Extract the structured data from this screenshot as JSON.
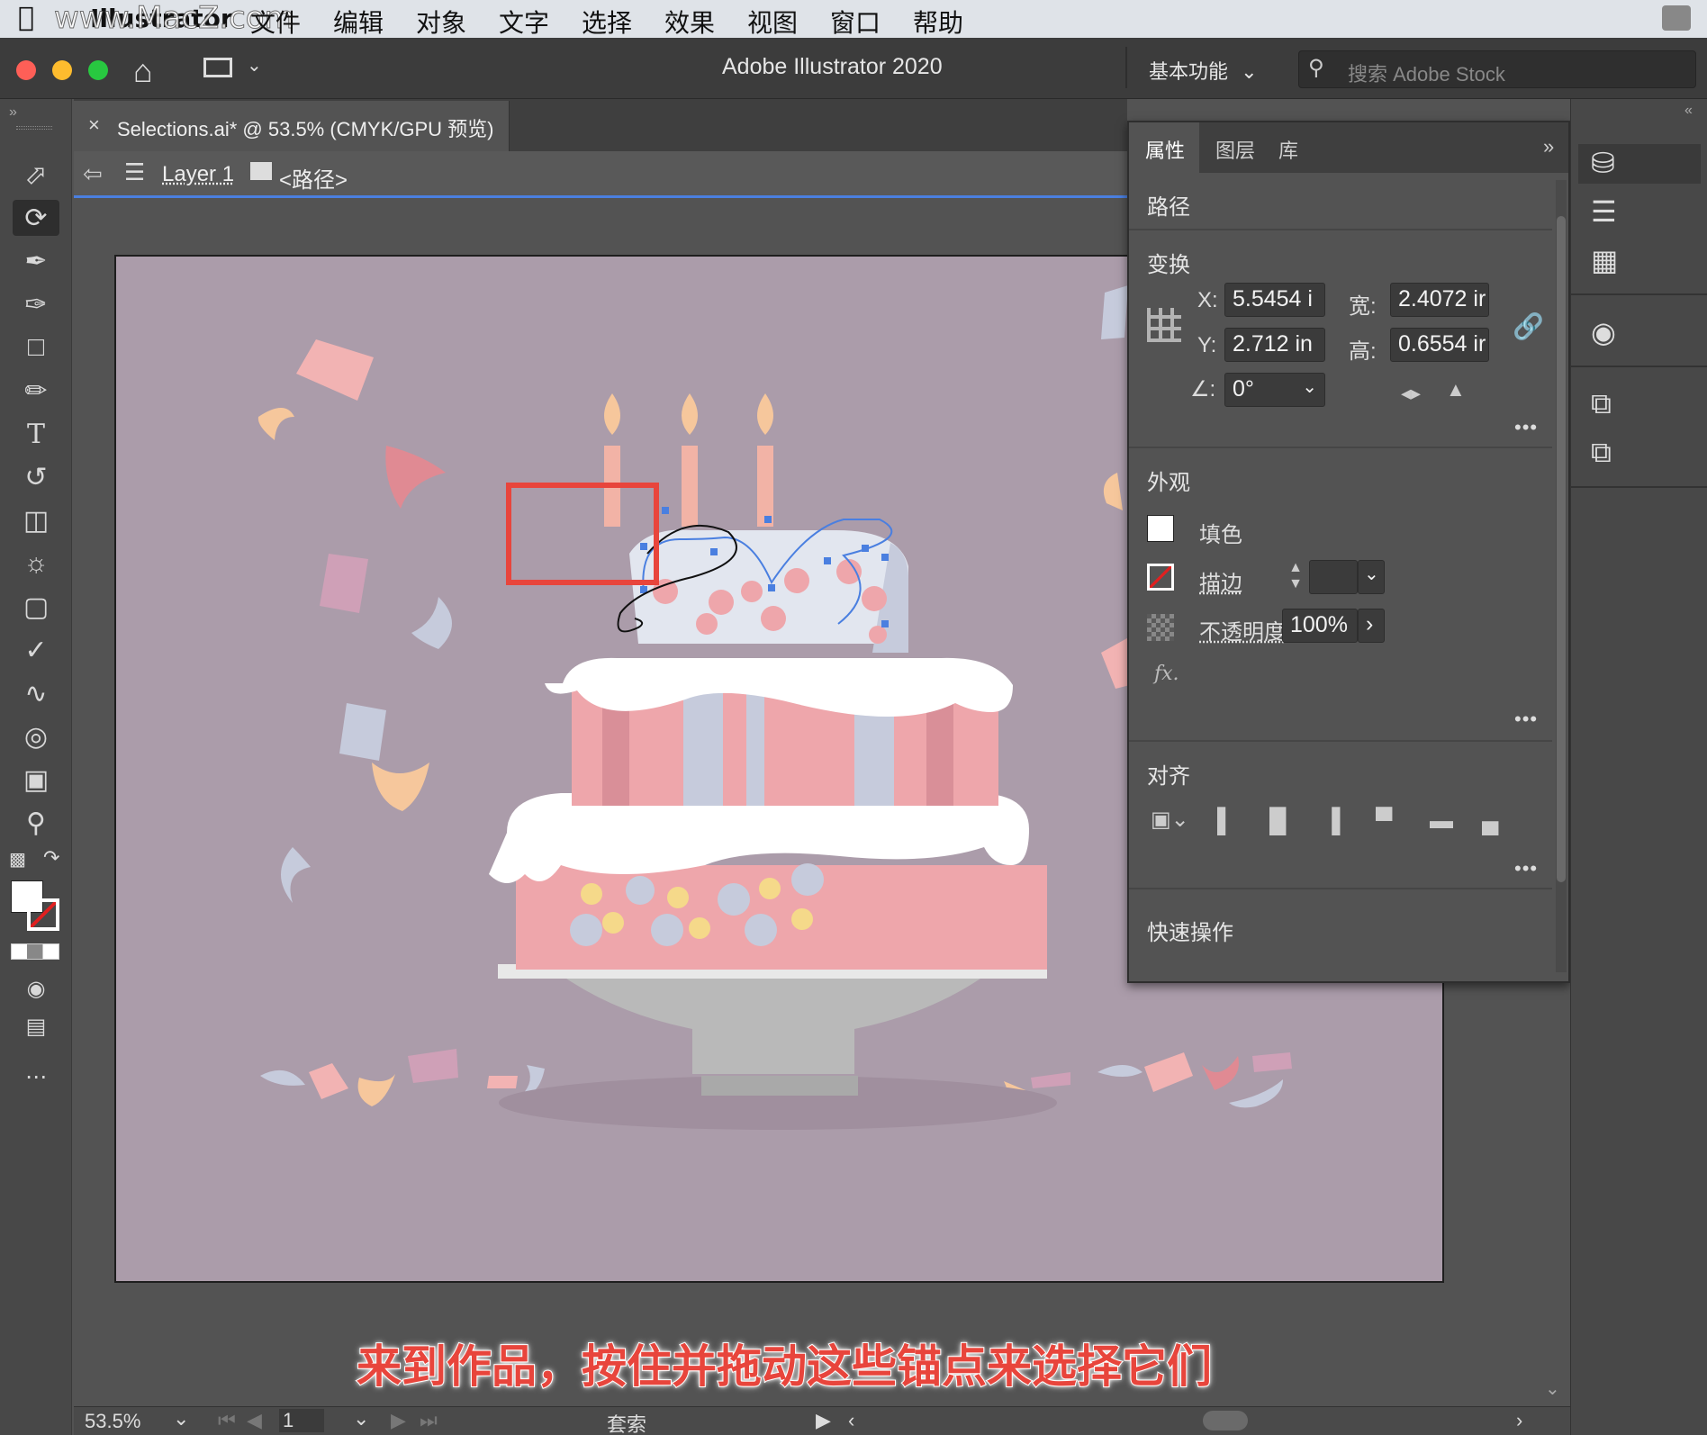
{
  "menubar": {
    "app_name": "Illustrator",
    "watermark": "www.MacZ.com",
    "items": [
      "文件",
      "编辑",
      "对象",
      "文字",
      "选择",
      "效果",
      "视图",
      "窗口",
      "帮助"
    ]
  },
  "titlebar": {
    "title": "Adobe Illustrator 2020",
    "workspace": "基本功能",
    "search_placeholder": "搜索 Adobe Stock"
  },
  "document": {
    "tab_title": "Selections.ai* @ 53.5% (CMYK/GPU 预览)",
    "layer": "Layer 1",
    "path_label": "<路径>"
  },
  "panel": {
    "tabs": [
      "属性",
      "图层",
      "库"
    ],
    "selection_type": "路径",
    "transform": {
      "title": "变换",
      "x_label": "X:",
      "x": "5.5454 i",
      "y_label": "Y:",
      "y": "2.712 in",
      "w_label": "宽:",
      "w": "2.4072 ir",
      "h_label": "高:",
      "h": "0.6554 ir",
      "angle": "0°"
    },
    "appearance": {
      "title": "外观",
      "fill": "填色",
      "stroke": "描边",
      "opacity_label": "不透明度",
      "opacity": "100%",
      "fx": "fx."
    },
    "align": {
      "title": "对齐"
    },
    "quick_actions": {
      "title": "快速操作"
    }
  },
  "statusbar": {
    "zoom": "53.5%",
    "artboard": "1",
    "tool_name": "套索"
  },
  "caption": "来到作品，按住并拖动这些锚点来选择它们",
  "colors": {
    "artboard_bg": "#ab9caa",
    "accent": "#4a7fe0",
    "highlight_box": "#e8453c",
    "cake_pink": "#eea6ab",
    "icing": "#ffffff"
  }
}
